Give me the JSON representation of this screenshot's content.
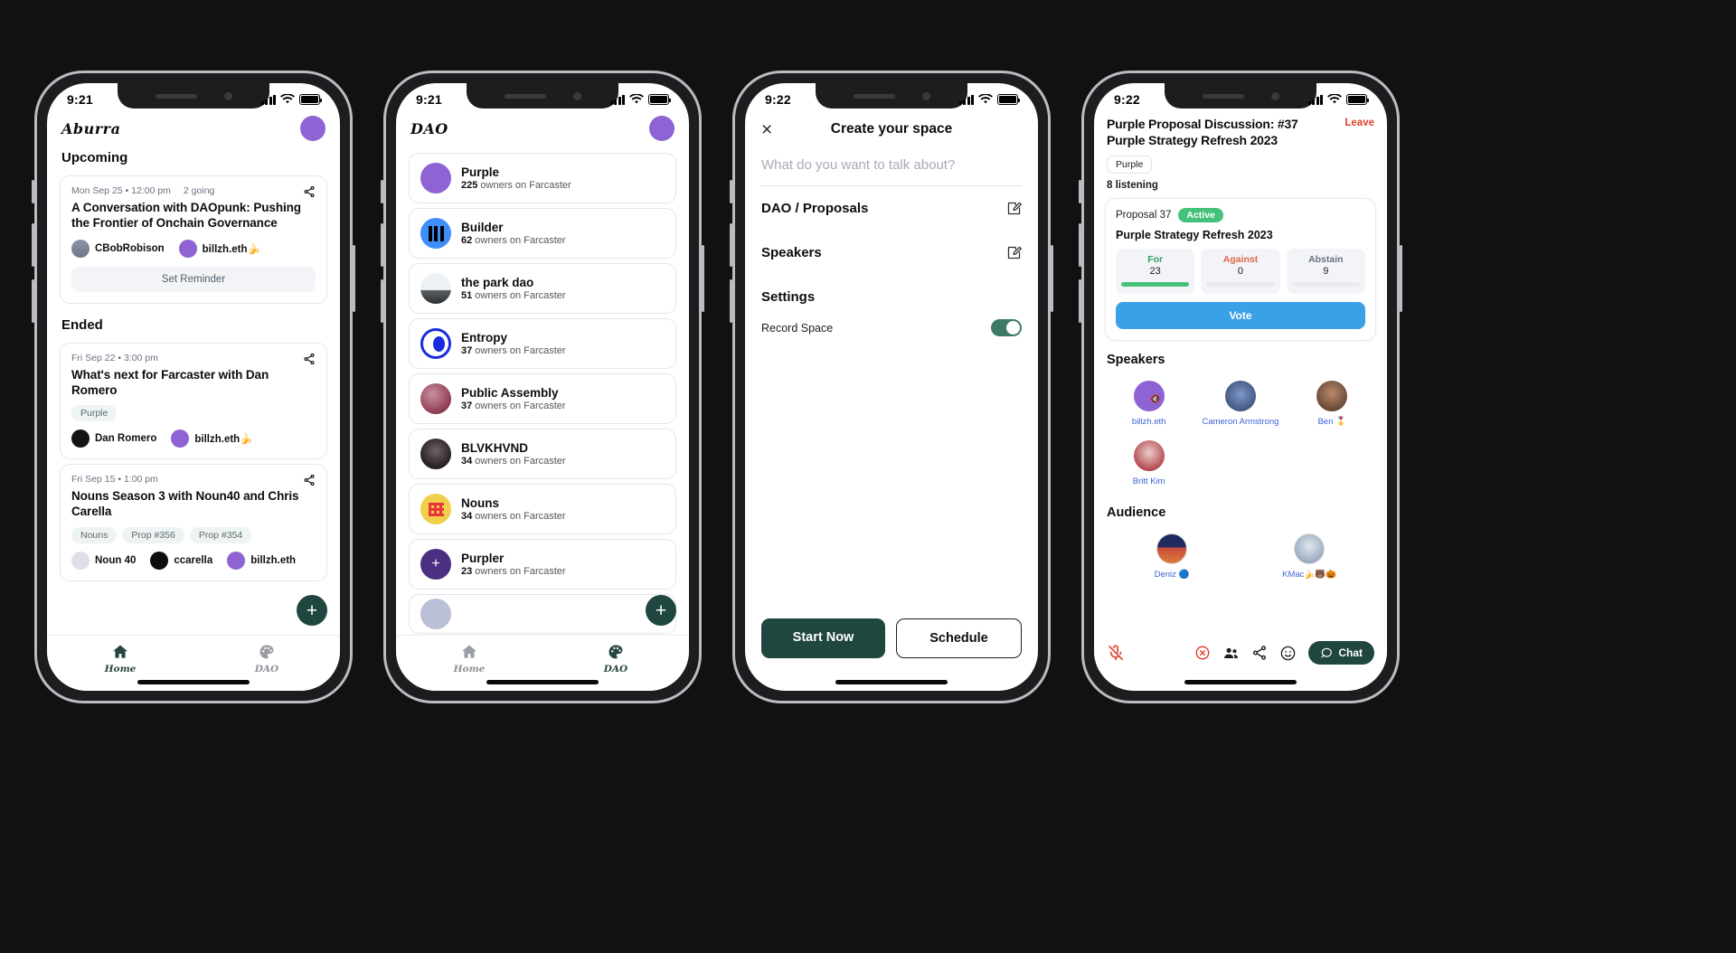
{
  "phones": {
    "phone1": {
      "status": {
        "time": "9:21"
      },
      "header": {
        "brand": "Aburra",
        "avatar": "user-avatar"
      },
      "sections": [
        {
          "title": "Upcoming"
        },
        {
          "title": "Ended"
        }
      ],
      "upcoming": [
        {
          "date": "Mon Sep 25 • 12:00 pm",
          "going": "2 going",
          "title": "A Conversation with DAOpunk: Pushing the Frontier of Onchain Governance",
          "tags": [],
          "people": [
            {
              "name": "CBobRobison",
              "avatar": "cbob-avatar"
            },
            {
              "name": "billzh.eth🍌",
              "avatar": "purple-avatar"
            }
          ],
          "action": "Set Reminder"
        }
      ],
      "ended": [
        {
          "date": "Fri Sep 22 • 3:00 pm",
          "title": "What's next for Farcaster with Dan Romero",
          "tags": [
            "Purple"
          ],
          "people": [
            {
              "name": "Dan Romero",
              "avatar": "dan-avatar"
            },
            {
              "name": "billzh.eth🍌",
              "avatar": "purple-avatar"
            }
          ]
        },
        {
          "date": "Fri Sep 15 • 1:00 pm",
          "title": "Nouns Season 3 with Noun40 and Chris Carella",
          "tags": [
            "Nouns",
            "Prop #356",
            "Prop #354"
          ],
          "people": [
            {
              "name": "Noun 40",
              "avatar": "noun-avatar"
            },
            {
              "name": "ccarella",
              "avatar": "ccarella-avatar"
            },
            {
              "name": "billzh.eth",
              "avatar": "purple-avatar"
            }
          ]
        }
      ],
      "fab": "+",
      "tabs": [
        {
          "label": "Home",
          "icon": "home-icon",
          "active": true
        },
        {
          "label": "DAO",
          "icon": "palette-icon",
          "active": false
        }
      ]
    },
    "phone2": {
      "status": {
        "time": "9:21"
      },
      "header": {
        "brand": "DAO",
        "avatar": "user-avatar"
      },
      "daos": [
        {
          "name": "Purple",
          "sub_count": "225",
          "sub_text": " owners on Farcaster",
          "avatar": "purple-circle"
        },
        {
          "name": "Builder",
          "sub_count": "62",
          "sub_text": " owners on Farcaster",
          "avatar": "builder-icon"
        },
        {
          "name": "the park dao",
          "sub_count": "51",
          "sub_text": " owners on Farcaster",
          "avatar": "park-photo"
        },
        {
          "name": "Entropy",
          "sub_count": "37",
          "sub_text": " owners on Farcaster",
          "avatar": "entropy-icon"
        },
        {
          "name": "Public Assembly",
          "sub_count": "37",
          "sub_text": " owners on Farcaster",
          "avatar": "assembly-photo"
        },
        {
          "name": "BLVKHVND",
          "sub_count": "34",
          "sub_text": " owners on Farcaster",
          "avatar": "blvkhvnd-photo"
        },
        {
          "name": "Nouns",
          "sub_count": "34",
          "sub_text": " owners on Farcaster",
          "avatar": "nouns-icon"
        },
        {
          "name": "Purpler",
          "sub_count": "23",
          "sub_text": " owners on Farcaster",
          "avatar": "purpler-icon"
        }
      ],
      "fab": "+",
      "tabs": [
        {
          "label": "Home",
          "icon": "home-icon",
          "active": false
        },
        {
          "label": "DAO",
          "icon": "palette-icon",
          "active": true
        }
      ]
    },
    "phone3": {
      "status": {
        "time": "9:22"
      },
      "header": {
        "close": "×",
        "title": "Create your space"
      },
      "topic_placeholder": "What do you want to talk about?",
      "rows": [
        {
          "label": "DAO / Proposals",
          "icon": "edit-icon"
        },
        {
          "label": "Speakers",
          "icon": "edit-icon"
        }
      ],
      "settings_label": "Settings",
      "record": {
        "label": "Record Space",
        "enabled": true
      },
      "actions": {
        "primary": "Start Now",
        "secondary": "Schedule"
      }
    },
    "phone4": {
      "status": {
        "time": "9:22"
      },
      "header": {
        "title": "Purple Proposal Discussion: #37 Purple Strategy Refresh 2023",
        "leave": "Leave",
        "chip": "Purple",
        "listening": "8 listening"
      },
      "proposal": {
        "id": "Proposal 37",
        "status": "Active",
        "name": "Purple Strategy Refresh 2023",
        "votes": [
          {
            "label": "For",
            "count": "23"
          },
          {
            "label": "Against",
            "count": "0"
          },
          {
            "label": "Abstain",
            "count": "9"
          }
        ],
        "vote_button": "Vote"
      },
      "speakers_title": "Speakers",
      "speakers": [
        {
          "name": "billzh.eth",
          "avatar": "purple-circle",
          "muted": true
        },
        {
          "name": "Cameron Armstrong",
          "avatar": "cameron-photo",
          "muted": false
        },
        {
          "name": "Ben 🎖️",
          "avatar": "ben-photo",
          "muted": false
        },
        {
          "name": "Britt Kim",
          "avatar": "britt-photo",
          "muted": false
        }
      ],
      "audience_title": "Audience",
      "audience": [
        {
          "name": "Deniz 🔵",
          "avatar": "deniz-photo"
        },
        {
          "name": "KMac🍌🐻🎃",
          "avatar": "kmac-photo"
        }
      ],
      "bottom": {
        "mic": "mic-muted-icon",
        "leave": "leave-call-icon",
        "people": "people-icon",
        "share": "share-icon",
        "emoji": "emoji-icon",
        "chat": "Chat"
      }
    }
  }
}
